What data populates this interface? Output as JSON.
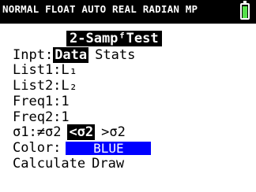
{
  "status_bar": {
    "text": "NORMAL FLOAT AUTO REAL RADIAN MP",
    "battery_fill_color": "#55e04a"
  },
  "title": "2-SampᶠTest",
  "input": {
    "label": "Inpt:",
    "options": [
      "Data",
      "Stats"
    ],
    "selected": "Data"
  },
  "list1": {
    "label": "List1:",
    "value": "L₁"
  },
  "list2": {
    "label": "List2:",
    "value": "L₂"
  },
  "freq1": {
    "label": "Freq1:",
    "value": "1"
  },
  "freq2": {
    "label": "Freq2:",
    "value": "1"
  },
  "sigma": {
    "label": "σ1:",
    "options": [
      "≠σ2",
      "<σ2",
      ">σ2"
    ],
    "selected": "<σ2"
  },
  "color": {
    "label": "Color:",
    "value": "BLUE",
    "swatch": "#0000ff"
  },
  "actions": {
    "calculate": "Calculate",
    "draw": "Draw"
  }
}
